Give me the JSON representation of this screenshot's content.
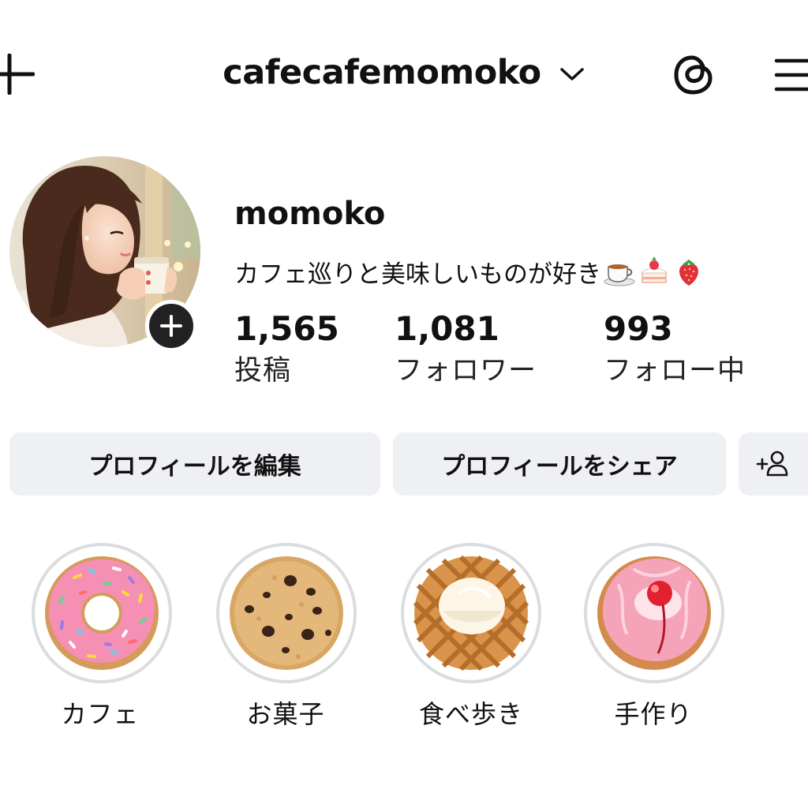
{
  "header": {
    "username": "cafecafemomoko",
    "icons": [
      "plus-icon",
      "chevron-down-icon",
      "threads-icon",
      "menu-icon"
    ]
  },
  "profile": {
    "display_name": "momoko",
    "bio": "カフェ巡りと美味しいものが好き",
    "bio_emoji": [
      "coffee-cup",
      "shortcake",
      "strawberry"
    ],
    "stats": [
      {
        "value": "1,565",
        "label": "投稿"
      },
      {
        "value": "1,081",
        "label": "フォロワー"
      },
      {
        "value": "993",
        "label": "フォロー中"
      }
    ]
  },
  "actions": {
    "edit_label": "プロフィールを編集",
    "share_label": "プロフィールをシェア"
  },
  "highlights": [
    {
      "label": "カフェ",
      "image": "pink-sprinkle-donut"
    },
    {
      "label": "お菓子",
      "image": "chocolate-chip-cookie"
    },
    {
      "label": "食べ歩き",
      "image": "waffle-with-ice-cream"
    },
    {
      "label": "手作り",
      "image": "pink-donut-with-cherry"
    }
  ],
  "colors": {
    "button_bg": "#eef0f3",
    "ring": "#dadce0",
    "text": "#111111"
  }
}
